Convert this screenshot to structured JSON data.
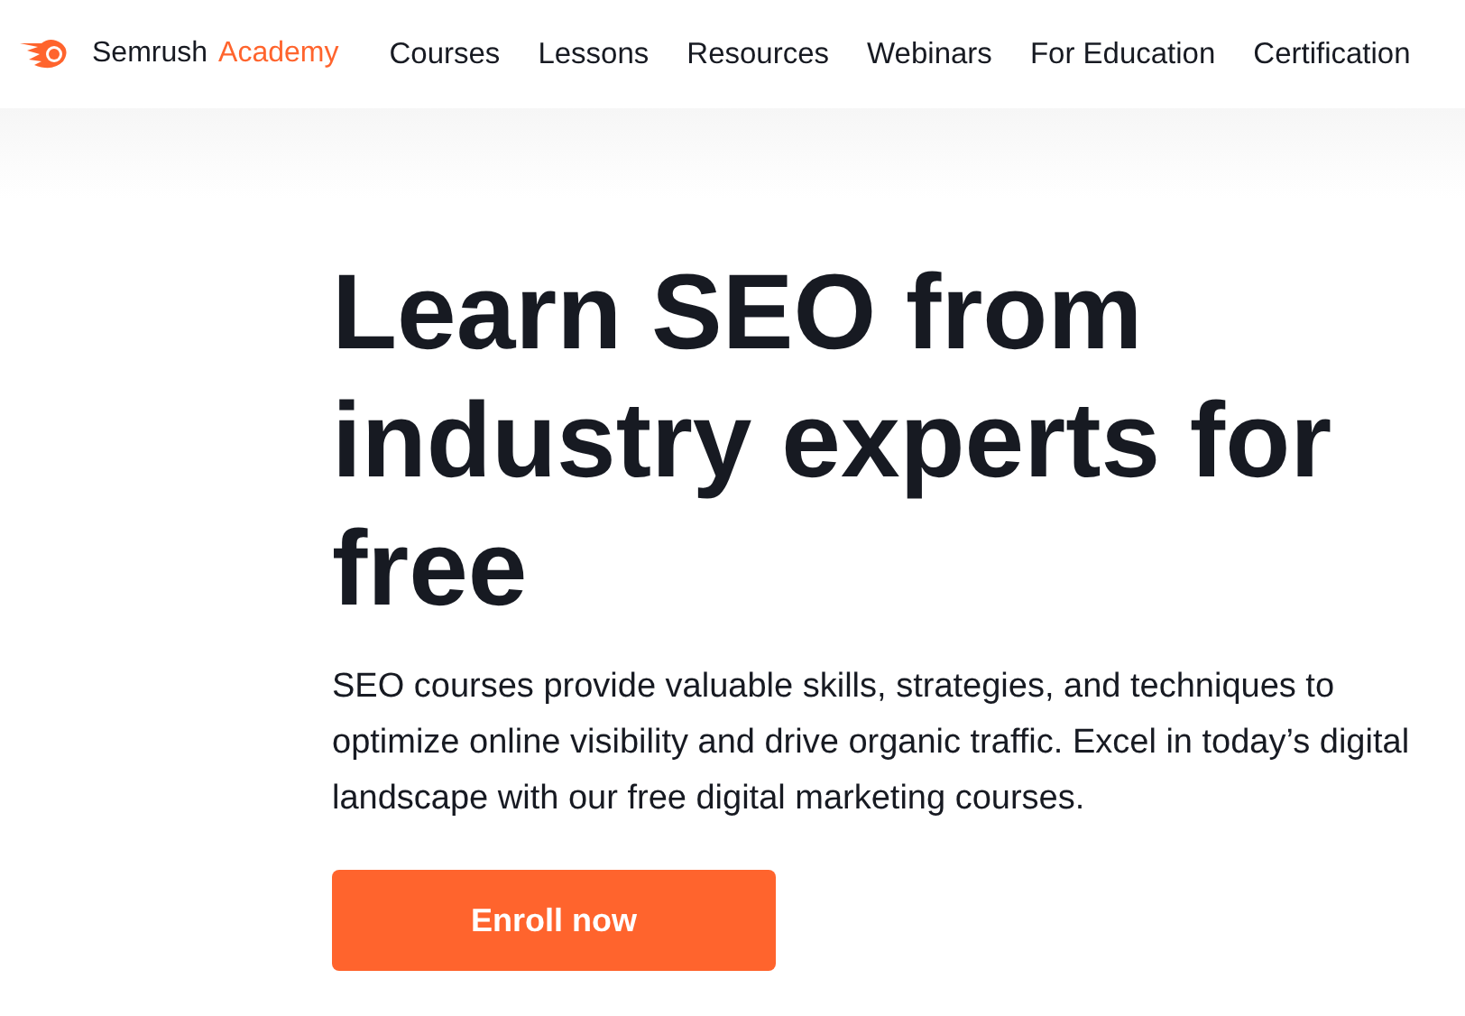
{
  "header": {
    "logo": {
      "brand": "Semrush",
      "product": "Academy"
    },
    "nav": [
      {
        "label": "Courses"
      },
      {
        "label": "Lessons"
      },
      {
        "label": "Resources"
      },
      {
        "label": "Webinars"
      },
      {
        "label": "For Education"
      },
      {
        "label": "Certification"
      }
    ]
  },
  "hero": {
    "title": "Learn SEO from industry experts for free",
    "description": "SEO courses provide valuable skills, strategies, and techniques to optimize online visibility and drive organic traffic. Excel in today’s digital landscape with our free digital marketing courses.",
    "button": "Enroll now"
  }
}
